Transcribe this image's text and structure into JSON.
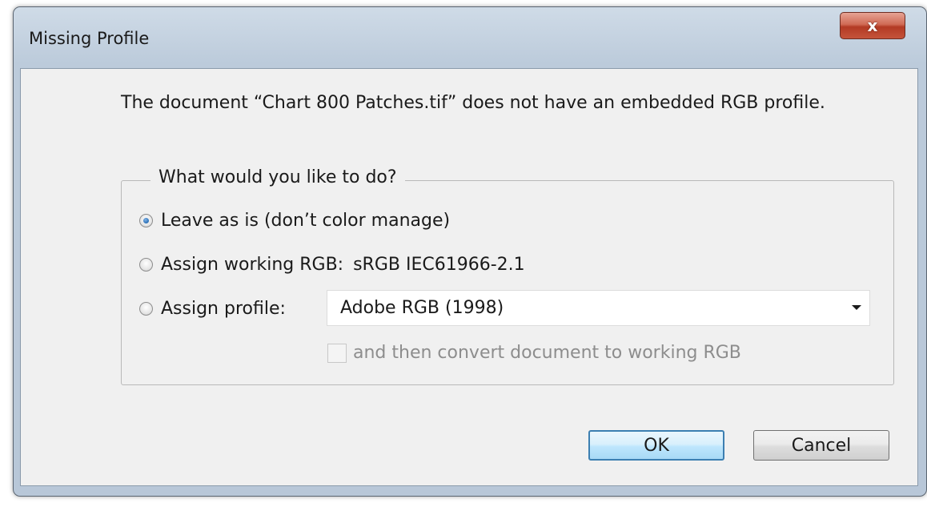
{
  "window": {
    "title": "Missing Profile",
    "close_glyph": "x"
  },
  "message": "The document “Chart 800 Patches.tif” does not have an embedded RGB profile.",
  "options": {
    "legend": "What would you like to do?",
    "leave_label": "Leave as is (don’t color manage)",
    "assign_working_label": "Assign working RGB:",
    "working_rgb_value": "sRGB IEC61966-2.1",
    "assign_profile_label": "Assign profile:",
    "profile_selected": "Adobe RGB (1998)",
    "convert_label": "and then convert document to working RGB",
    "selected_option": "leave"
  },
  "buttons": {
    "ok": "OK",
    "cancel": "Cancel"
  },
  "colors": {
    "ok_border": "#3c7fb1",
    "close_button": "#c4533a",
    "radio_selected": "#2a6fb6"
  }
}
